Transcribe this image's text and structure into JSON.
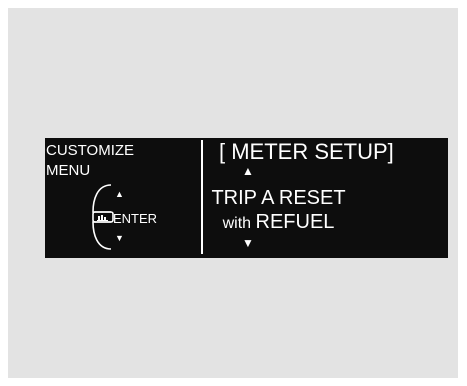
{
  "menu": {
    "title": "CUSTOMIZE\nMENU",
    "enter_label": "ENTER",
    "up_arrow": "▲",
    "down_arrow": "▼"
  },
  "screen": {
    "title": "[ METER SETUP]",
    "up_arrow": "▲",
    "line1": "TRIP A RESET",
    "line2_with": "with",
    "line2_refuel": "REFUEL",
    "down_arrow": "▼"
  },
  "colors": {
    "background": "#e3e3e3",
    "display": "#0d0d0d",
    "text": "#ffffff"
  },
  "icons": {
    "controller": "selector-wheel-icon"
  }
}
